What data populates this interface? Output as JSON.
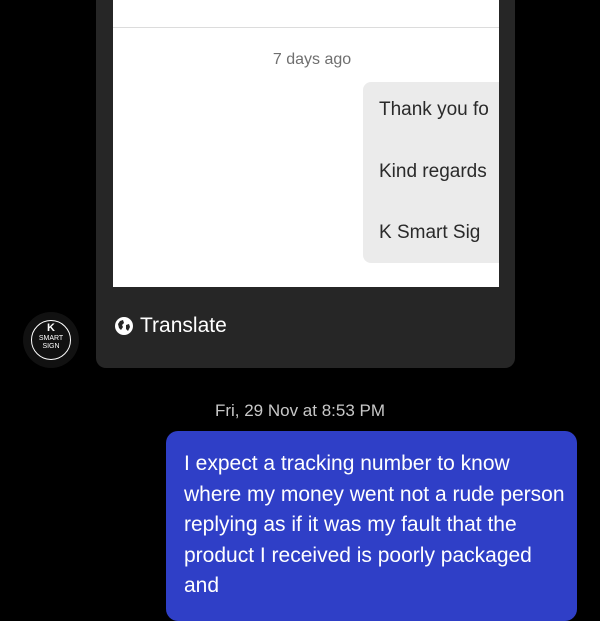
{
  "colors": {
    "background": "#000000",
    "card": "#262626",
    "outgoing_bubble": "#2f3fc7",
    "quoted_bubble": "#ebebeb"
  },
  "attachment": {
    "time": "7 days ago",
    "lines": [
      "Thank you fo",
      "Kind regards",
      "K Smart Sig"
    ]
  },
  "translate_label": "Translate",
  "avatar": {
    "logo_letter": "K",
    "logo_words": [
      "SMART",
      "SIGN"
    ]
  },
  "message": {
    "timestamp": "Fri, 29 Nov at 8:53 PM",
    "text": "I expect a tracking number to know where my money went not a rude person replying as if it was my fault that the product I received is poorly packaged and"
  },
  "icons": {
    "translate": "globe-icon"
  }
}
